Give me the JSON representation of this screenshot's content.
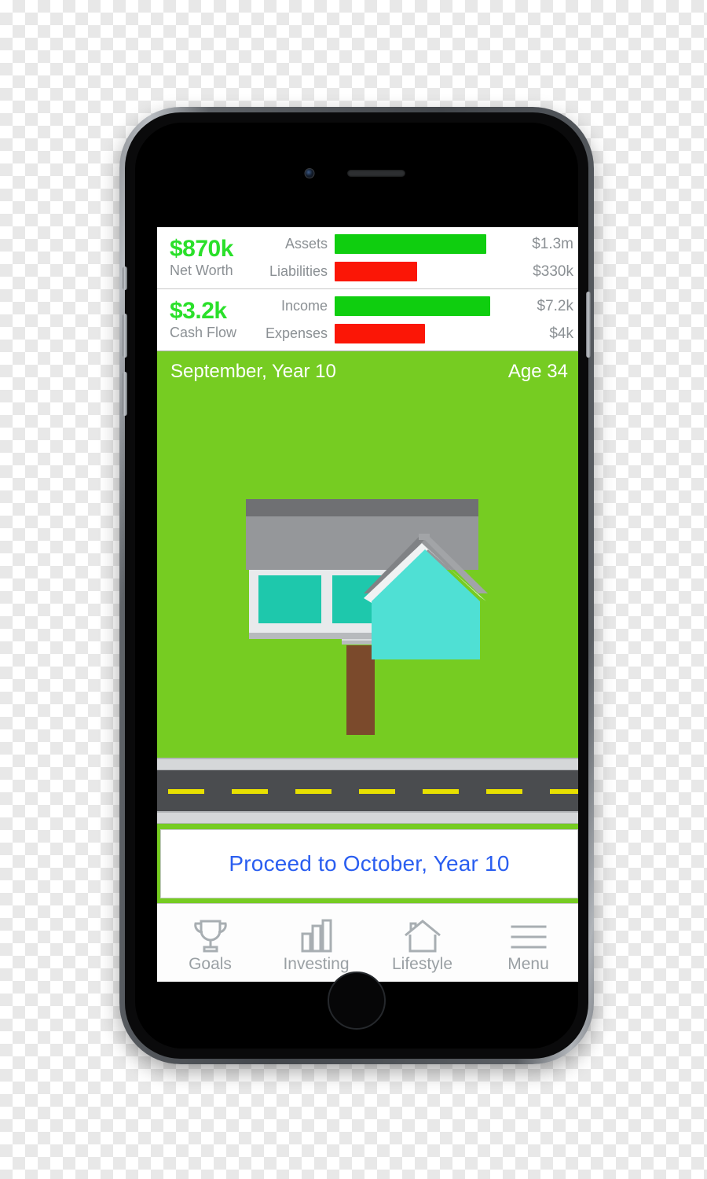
{
  "app": {
    "device": "iphone",
    "screen_name": "lifestyle-dashboard"
  },
  "summary": {
    "net_worth": {
      "amount": "$870k",
      "label": "Net Worth",
      "bars": [
        {
          "name": "Assets",
          "value": "$1.3m",
          "color": "#0fce0f",
          "pct": 100
        },
        {
          "name": "Liabilities",
          "value": "$330k",
          "color": "#fb1606",
          "pct": 54
        }
      ]
    },
    "cash_flow": {
      "amount": "$3.2k",
      "label": "Cash Flow",
      "bars": [
        {
          "name": "Income",
          "value": "$7.2k",
          "color": "#0fce0f",
          "pct": 100
        },
        {
          "name": "Expenses",
          "value": "$4k",
          "color": "#fb1606",
          "pct": 54
        }
      ]
    }
  },
  "scene": {
    "date": "September, Year 10",
    "age": "Age 34",
    "field_color": "#76cc22",
    "house": {
      "roof_dark": "#6f7073",
      "roof_main": "#95979a",
      "roof_gable_left": "#808285",
      "roof_gable_right": "#a2a4a7",
      "trim": "#e8eaec",
      "wall_left": "#1ec8ac",
      "wall_right": "#4fe0d4",
      "post": "#7b4a2c",
      "deck": "#c6c9cc"
    },
    "road": {
      "asphalt_color": "#4a4c4f",
      "curb_color": "#d5d7d9",
      "dash_color": "#e8e000",
      "dash_count": 7
    }
  },
  "proceed": {
    "label": "Proceed to October, Year 10",
    "text_color": "#2a5ef0"
  },
  "tabs": [
    {
      "label": "Goals",
      "icon": "trophy-icon"
    },
    {
      "label": "Investing",
      "icon": "bar-chart-icon"
    },
    {
      "label": "Lifestyle",
      "icon": "house-icon"
    },
    {
      "label": "Menu",
      "icon": "hamburger-icon"
    }
  ]
}
